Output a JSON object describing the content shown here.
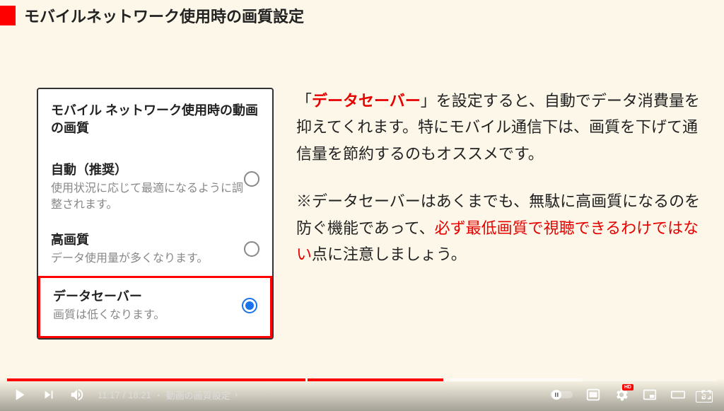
{
  "header": {
    "title": "モバイルネットワーク使用時の画質設定"
  },
  "phone": {
    "title": "モバイル ネットワーク使用時の動画の画質",
    "options": [
      {
        "title": "自動（推奨）",
        "desc": "使用状況に応じて最適になるように調整されます。",
        "selected": false
      },
      {
        "title": "高画質",
        "desc": "データ使用量が多くなります。",
        "selected": false
      },
      {
        "title": "データセーバー",
        "desc": "画質は低くなります。",
        "selected": true
      }
    ]
  },
  "explanation": {
    "p1_open": "「",
    "p1_hl": "データセーバー",
    "p1_rest": "」を設定すると、自動でデータ消費量を抑えてくれます。特にモバイル通信下は、画質を下げて通信量を節約するのもオススメです。",
    "p2_pre": "※データセーバーはあくまでも、無駄に高画質になるのを防ぐ機能であって、",
    "p2_hl": "必ず最低画質で視聴できるわけではない",
    "p2_post": "点に注意しましょう。"
  },
  "player": {
    "current_time": "11:17",
    "total_time": "18:21",
    "chapter_sep": "・",
    "chapter_title": "動画の画質設定",
    "hd_label": "HD",
    "count": "3"
  }
}
